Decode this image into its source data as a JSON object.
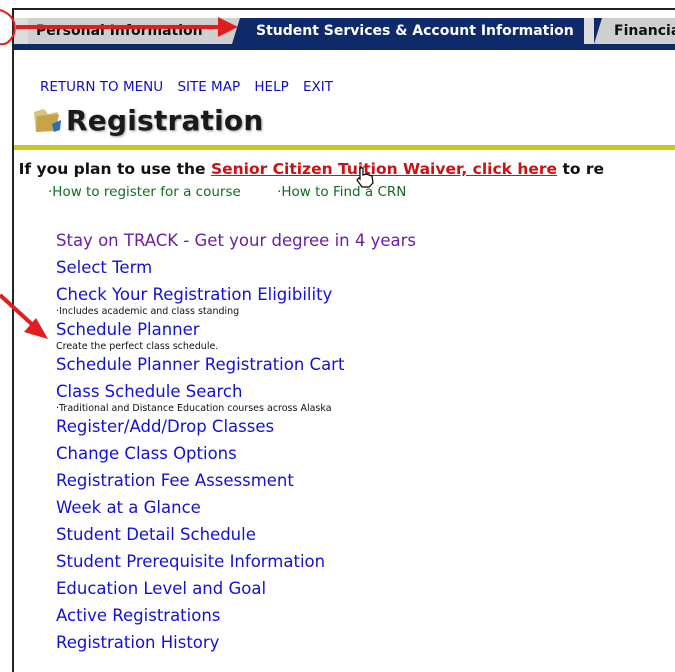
{
  "tabs": {
    "left": "Personal Information",
    "active": "Student Services & Account Information",
    "right": "Financial Aid"
  },
  "topnav": {
    "return": "RETURN TO MENU",
    "sitemap": "SITE MAP",
    "help": "HELP",
    "exit": "EXIT"
  },
  "page": {
    "title": "Registration"
  },
  "notice": {
    "before": "If you plan to use the ",
    "link": "Senior Citizen Tuition Waiver, click here",
    "after": " to re"
  },
  "howto": {
    "register": "·How to register for a course",
    "crn": "·How to Find a CRN"
  },
  "menu": {
    "track": "Stay on TRACK - Get your degree in 4 years",
    "select_term": "Select Term",
    "eligibility": "Check Your Registration Eligibility",
    "eligibility_sub": "·Includes academic and class standing",
    "planner": "Schedule Planner",
    "planner_sub": "Create the perfect class schedule.",
    "planner_cart": "Schedule Planner Registration Cart",
    "class_search": "Class Schedule Search",
    "class_search_sub": "·Traditional and Distance Education courses across Alaska",
    "add_drop": "Register/Add/Drop Classes",
    "change_options": "Change Class Options",
    "fee": "Registration Fee Assessment",
    "week": "Week at a Glance",
    "detail": "Student Detail Schedule",
    "prereq": "Student Prerequisite Information",
    "education": "Education Level and Goal",
    "active": "Active Registrations",
    "history": "Registration History"
  },
  "colors": {
    "nav_blue": "#0f2a6b",
    "link_blue": "#1212d4",
    "visited_purple": "#6b1fa8",
    "howto_green": "#116d1f",
    "divider_olive": "#c8c81e",
    "alert_red": "#d01010"
  }
}
